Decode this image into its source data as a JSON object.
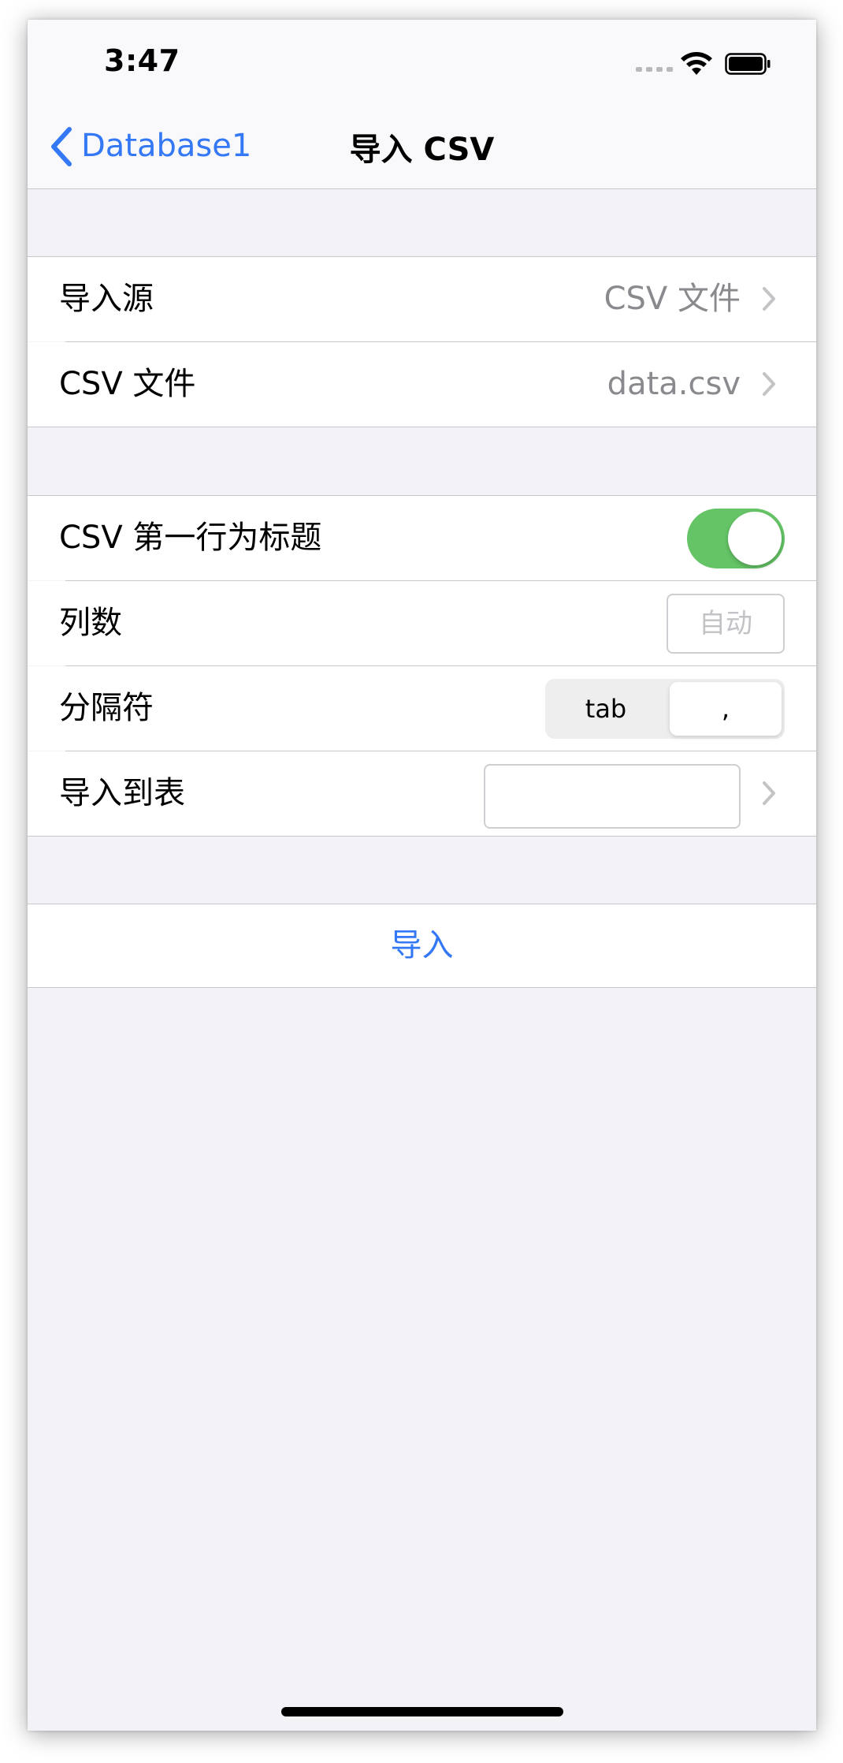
{
  "status_bar": {
    "time": "3:47"
  },
  "nav": {
    "back_label": "Database1",
    "title": "导入 CSV"
  },
  "section1": {
    "rows": [
      {
        "label": "导入源",
        "value": "CSV 文件"
      },
      {
        "label": "CSV 文件",
        "value": "data.csv"
      }
    ]
  },
  "section2": {
    "header_row": {
      "label": "CSV 第一行为标题",
      "toggle_on": true
    },
    "columns_row": {
      "label": "列数",
      "placeholder": "自动"
    },
    "delimiter_row": {
      "label": "分隔符",
      "options": [
        "tab",
        ","
      ],
      "selected": ","
    },
    "table_row": {
      "label": "导入到表",
      "value": ""
    }
  },
  "action": {
    "import_label": "导入"
  },
  "colors": {
    "accent": "#3478f6",
    "toggle_on": "#65c466",
    "background": "#f2f2f7"
  }
}
